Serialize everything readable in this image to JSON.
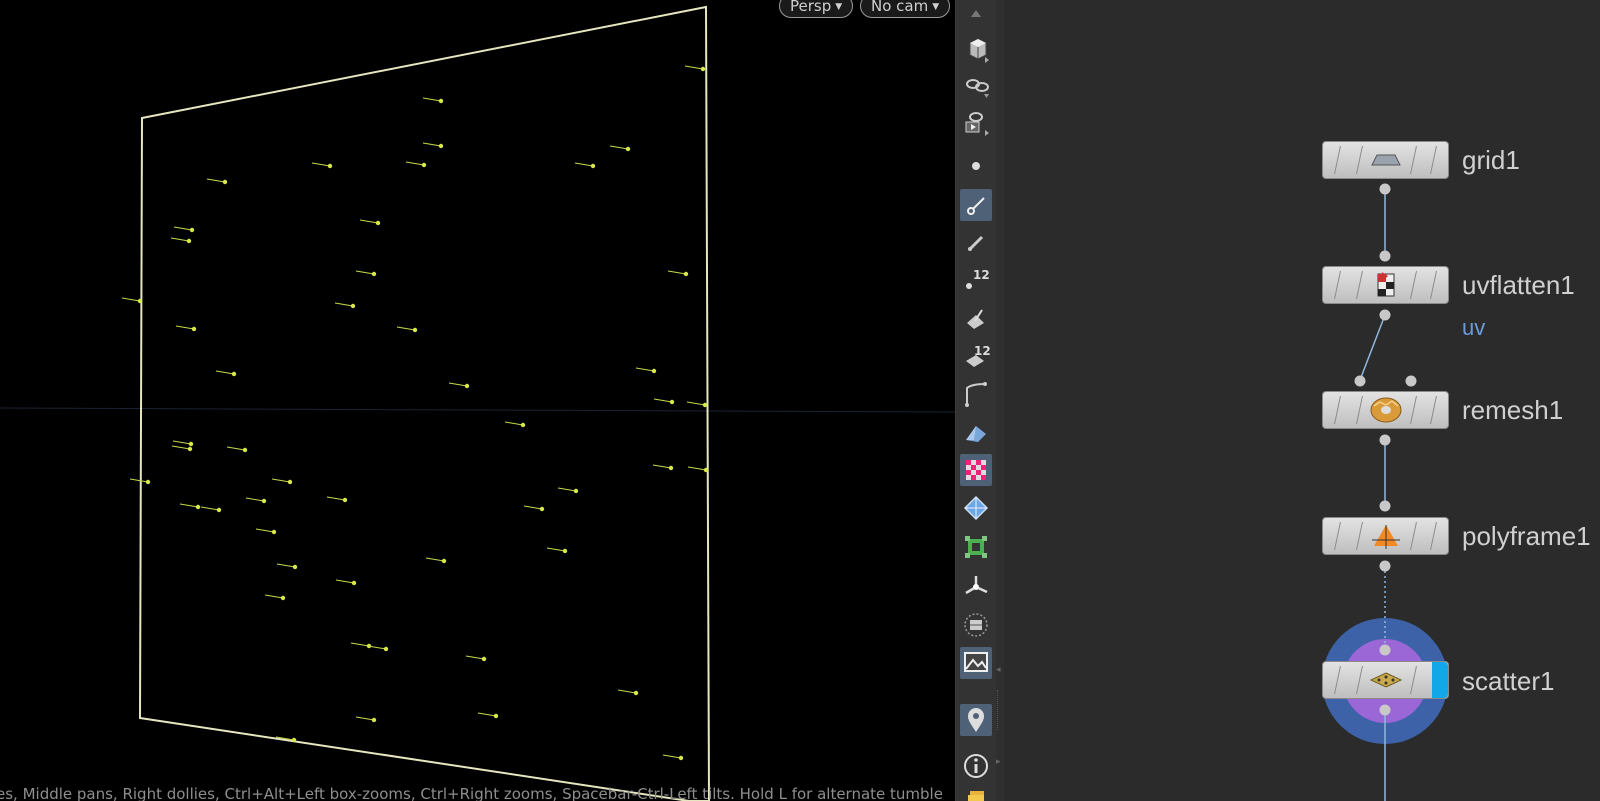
{
  "viewport": {
    "persp_label": "Persp",
    "cam_label": "No cam",
    "status_text": "es, Middle pans, Right dollies, Ctrl+Alt+Left box-zooms, Ctrl+Right zooms, Spacebar-Ctrl-Left tilts. Hold L for alternate tumble",
    "background_color": "#000000",
    "grid_outline_color": "#e6e6c0",
    "point_color": "#d7e84b"
  },
  "toolbar": {
    "items": [
      {
        "name": "scroll-up-icon",
        "active": false
      },
      {
        "name": "display-options-icon",
        "active": false
      },
      {
        "name": "ghost-view-icon",
        "active": false
      },
      {
        "name": "flipbook-icon",
        "active": false
      },
      {
        "name": "point-display-icon",
        "active": false
      },
      {
        "name": "normal-display-icon",
        "active": true
      },
      {
        "name": "vector-display-icon",
        "active": false
      },
      {
        "name": "point-numbers-icon",
        "active": false,
        "badge": "12"
      },
      {
        "name": "prim-normals-icon",
        "active": false
      },
      {
        "name": "prim-numbers-icon",
        "active": false,
        "badge": "12"
      },
      {
        "name": "hull-display-icon",
        "active": false
      },
      {
        "name": "uv-display-icon",
        "active": false
      },
      {
        "name": "checker-texture-icon",
        "active": true
      },
      {
        "name": "wireframe-shaded-icon",
        "active": false
      },
      {
        "name": "uv-boundary-icon",
        "active": false
      },
      {
        "name": "origin-axes-icon",
        "active": false
      },
      {
        "name": "background-icon",
        "active": false
      },
      {
        "name": "image-overlay-icon",
        "active": true
      },
      {
        "name": "location-pin-icon",
        "active": true
      },
      {
        "name": "info-icon",
        "active": false
      },
      {
        "name": "folder-icon",
        "active": false
      }
    ]
  },
  "network": {
    "wire_color": "#8fb8e0",
    "nodes": [
      {
        "id": "grid1",
        "label": "grid1",
        "icon": "grid-node-icon"
      },
      {
        "id": "uvflatten1",
        "label": "uvflatten1",
        "icon": "uvflatten-node-icon",
        "sub": "uv"
      },
      {
        "id": "remesh1",
        "label": "remesh1",
        "icon": "remesh-node-icon"
      },
      {
        "id": "polyframe1",
        "label": "polyframe1",
        "icon": "polyframe-node-icon"
      },
      {
        "id": "scatter1",
        "label": "scatter1",
        "icon": "scatter-node-icon",
        "display_flag": true,
        "highlight_colors": [
          "#3d62a8",
          "#9b66d6"
        ]
      }
    ]
  }
}
